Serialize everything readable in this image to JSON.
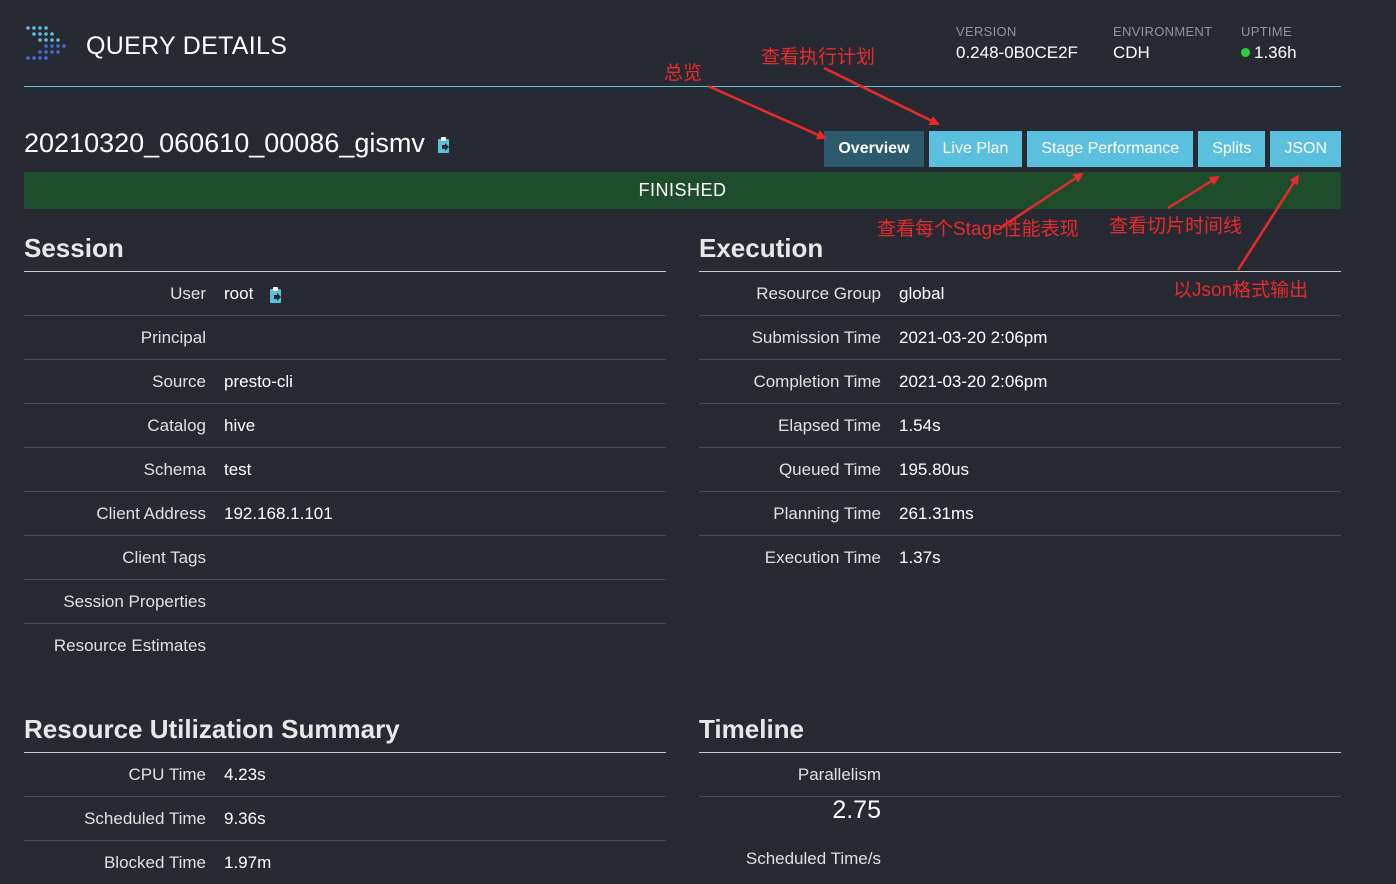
{
  "header": {
    "title": "QUERY DETAILS",
    "version_label": "VERSION",
    "version": "0.248-0B0CE2F",
    "environment_label": "ENVIRONMENT",
    "environment": "CDH",
    "uptime_label": "UPTIME",
    "uptime": "1.36h"
  },
  "query": {
    "id": "20210320_060610_00086_gismv",
    "state": "FINISHED"
  },
  "tabs": [
    {
      "label": "Overview",
      "active": true
    },
    {
      "label": "Live Plan",
      "active": false
    },
    {
      "label": "Stage Performance",
      "active": false
    },
    {
      "label": "Splits",
      "active": false
    },
    {
      "label": "JSON",
      "active": false
    }
  ],
  "session": {
    "title": "Session",
    "rows": [
      {
        "label": "User",
        "value": "root"
      },
      {
        "label": "Principal",
        "value": ""
      },
      {
        "label": "Source",
        "value": "presto-cli"
      },
      {
        "label": "Catalog",
        "value": "hive"
      },
      {
        "label": "Schema",
        "value": "test"
      },
      {
        "label": "Client Address",
        "value": "192.168.1.101"
      },
      {
        "label": "Client Tags",
        "value": ""
      },
      {
        "label": "Session Properties",
        "value": ""
      },
      {
        "label": "Resource Estimates",
        "value": ""
      }
    ]
  },
  "execution": {
    "title": "Execution",
    "rows": [
      {
        "label": "Resource Group",
        "value": "global"
      },
      {
        "label": "Submission Time",
        "value": "2021-03-20 2:06pm"
      },
      {
        "label": "Completion Time",
        "value": "2021-03-20 2:06pm"
      },
      {
        "label": "Elapsed Time",
        "value": "1.54s"
      },
      {
        "label": "Queued Time",
        "value": "195.80us"
      },
      {
        "label": "Planning Time",
        "value": "261.31ms"
      },
      {
        "label": "Execution Time",
        "value": "1.37s"
      }
    ]
  },
  "utilization": {
    "title": "Resource Utilization Summary",
    "rows": [
      {
        "label": "CPU Time",
        "value": "4.23s"
      },
      {
        "label": "Scheduled Time",
        "value": "9.36s"
      },
      {
        "label": "Blocked Time",
        "value": "1.97m"
      }
    ]
  },
  "timeline": {
    "title": "Timeline",
    "parallelism_label": "Parallelism",
    "parallelism_value": "2.75",
    "scheduled_label": "Scheduled Time/s"
  },
  "annotations": {
    "overview": "总览",
    "live_plan": "查看执行计划",
    "stage_perf": "查看每个Stage性能表现",
    "splits": "查看切片时间线",
    "json": "以Json格式输出"
  },
  "colors": {
    "background": "#272a33",
    "accent": "#5bc0de",
    "active_tab": "#2d5b6e",
    "finished": "#1e4d2b",
    "annotation": "#e82a2a",
    "uptime_dot": "#2ecc40"
  }
}
